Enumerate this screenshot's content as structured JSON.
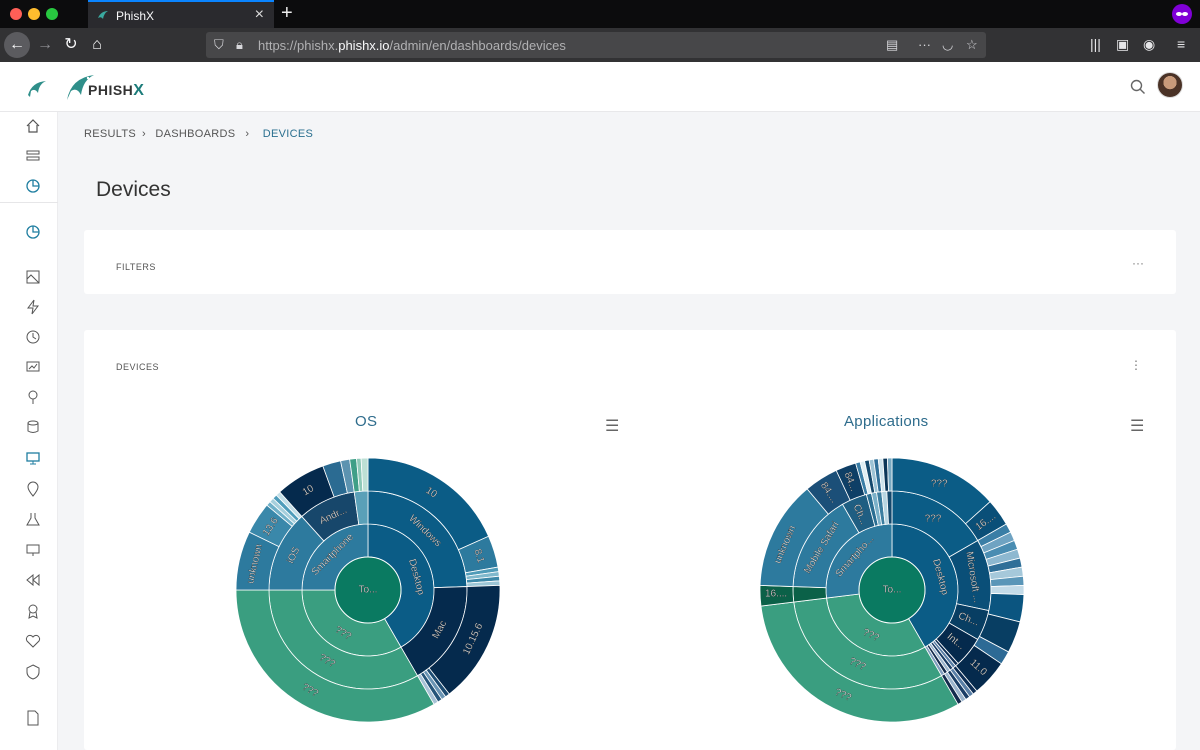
{
  "browser": {
    "tab_title": "PhishX",
    "url_prefix": "https://phishx.",
    "url_host": "phishx.io",
    "url_path": "/admin/en/dashboards/devices"
  },
  "app": {
    "brand": "PHISH",
    "brand_x": "X"
  },
  "breadcrumb": {
    "items": [
      "RESULTS",
      "DASHBOARDS",
      "DEVICES"
    ]
  },
  "page": {
    "title": "Devices"
  },
  "filters_card": {
    "label": "FILTERS",
    "menu": "···"
  },
  "devices_card": {
    "label": "DEVICES",
    "menu": "⋮"
  },
  "colors": {
    "teal_dark": "#0a7a61",
    "teal": "#3a9e80",
    "blue": "#0b5c86",
    "navy": "#052a4d",
    "steel": "#2d7a9e"
  },
  "chart_data": [
    {
      "type": "sunburst",
      "title": "OS",
      "center": "To...",
      "labels": [
        "Desktop",
        "Windows",
        "10",
        "8.1",
        "Mac",
        "10.15.6",
        "Smartphone",
        "iOS",
        "13.6",
        "Andr...",
        "10",
        "unknown",
        "???",
        "???",
        "???"
      ]
    },
    {
      "type": "sunburst",
      "title": "Applications",
      "center": "To...",
      "labels": [
        "Desktop",
        "???",
        "???",
        "Microsoft ...",
        "16....",
        "Ch...",
        "Int...",
        "11.0",
        "Smartpho...",
        "Mobile Safari",
        "unknown",
        "Ch...",
        "84....",
        "84...",
        "16....",
        "???",
        "???",
        "???"
      ]
    }
  ]
}
